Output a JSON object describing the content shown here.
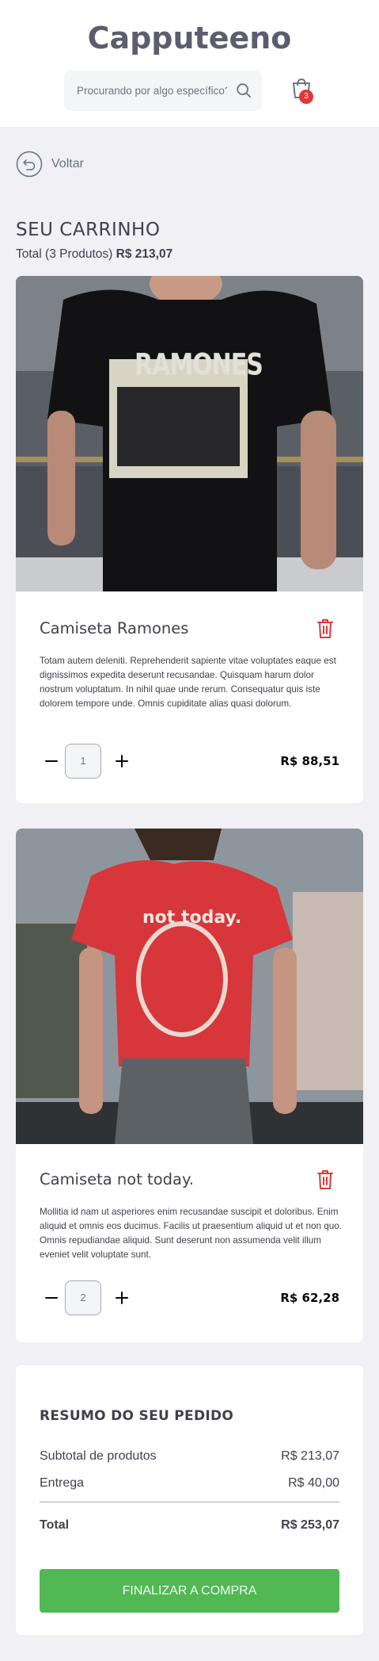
{
  "header": {
    "logo": "Capputeeno",
    "search": {
      "placeholder": "Procurando por algo específico?",
      "value": ""
    },
    "cart_count": "3"
  },
  "nav": {
    "back_label": "Voltar"
  },
  "cart": {
    "title": "SEU CARRINHO",
    "total_prefix": "Total (3 Produtos)",
    "total_value": "R$ 213,07",
    "items": [
      {
        "name": "Camiseta Ramones",
        "description": "Totam autem deleniti. Reprehenderit sapiente vitae voluptates eaque est dignissimos expedita deserunt recusandae. Quisquam harum dolor nostrum voluptatum. In nihil quae unde rerum. Consequatur quis iste dolorem tempore unde. Omnis cupiditate alias quasi dolorum.",
        "quantity": "1",
        "price": "R$ 88,51",
        "image_icon": "ramones-tshirt-photo",
        "image_text": "RAMONES"
      },
      {
        "name": "Camiseta not today.",
        "description": "Mollitia id nam ut asperiores enim recusandae suscipit et doloribus. Enim aliquid et omnis eos ducimus. Facilis ut praesentium aliquid ut et non quo. Omnis repudiandae aliquid. Sunt deserunt non assumenda velit illum eveniet velit voluptate sunt.",
        "quantity": "2",
        "price": "R$ 62,28",
        "image_icon": "not-today-tshirt-photo",
        "image_text": "not today."
      }
    ]
  },
  "summary": {
    "title": "RESUMO DO SEU PEDIDO",
    "subtotal_label": "Subtotal de produtos",
    "subtotal_value": "R$ 213,07",
    "shipping_label": "Entrega",
    "shipping_value": "R$ 40,00",
    "total_label": "Total",
    "total_value": "R$ 253,07",
    "checkout_label": "FINALIZAR A COMPRA"
  },
  "colors": {
    "background": "#f0f0f5",
    "text": "#41414d",
    "accent_green": "#51b853",
    "danger_red": "#de3838",
    "muted": "#617480"
  }
}
